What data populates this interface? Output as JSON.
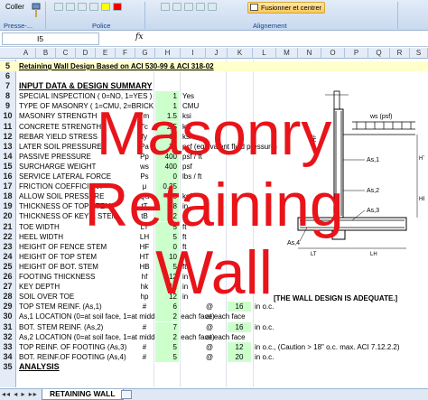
{
  "ribbon": {
    "paste_label": "Coller",
    "clipboard_group": "Presse-...",
    "font_group": "Police",
    "align_group": "Alignement",
    "merge_label": "Fusionner et centrer"
  },
  "formula_bar": {
    "name_box": "I5",
    "fx": "fx",
    "content": ""
  },
  "columns": [
    "A",
    "B",
    "C",
    "D",
    "E",
    "F",
    "G",
    "H",
    "I",
    "J",
    "K",
    "L",
    "M",
    "N",
    "O",
    "P",
    "Q",
    "R",
    "S"
  ],
  "title_row": {
    "num": "5",
    "text": "Retaining Wall Design Based on ACI 530-99 & ACI 318-02"
  },
  "rows": [
    {
      "num": "6",
      "label": "",
      "sym": "",
      "val": "",
      "unit": ""
    },
    {
      "num": "7",
      "label": "INPUT DATA & DESIGN SUMMARY",
      "sym": "",
      "val": "",
      "unit": ""
    },
    {
      "num": "8",
      "label": "SPECIAL INSPECTION ( 0=NO, 1=YES )",
      "sym": "",
      "val": "1",
      "unit": "Yes"
    },
    {
      "num": "9",
      "label": "TYPE OF MASONRY ( 1=CMU, 2=BRICK )",
      "sym": "",
      "val": "1",
      "unit": "CMU"
    },
    {
      "num": "10",
      "label": "MASONRY STRENGTH",
      "sym": "f'm",
      "val": "1.5",
      "unit": "ksi"
    },
    {
      "num": "11",
      "label": "CONCRETE STRENGTH",
      "sym": "f'c",
      "val": "2.5",
      "unit": "ksi"
    },
    {
      "num": "12",
      "label": "REBAR YIELD STRESS",
      "sym": "fy",
      "val": "60",
      "unit": "ksi"
    },
    {
      "num": "13",
      "label": "LATER SOIL PRESSURE",
      "sym": "Pa",
      "val": "30",
      "unit": "pcf (equivalent fluid pressure)"
    },
    {
      "num": "14",
      "label": "PASSIVE PRESSURE",
      "sym": "Pp",
      "val": "400",
      "unit": "psf / ft"
    },
    {
      "num": "15",
      "label": "SURCHARGE WEIGHT",
      "sym": "ws",
      "val": "400",
      "unit": "psf"
    },
    {
      "num": "16",
      "label": "SERVICE LATERAL FORCE",
      "sym": "Ps",
      "val": "0",
      "unit": "lbs / ft"
    },
    {
      "num": "17",
      "label": "FRICTION COEFFICIENT",
      "sym": "μ",
      "val": "0.35",
      "unit": ""
    },
    {
      "num": "18",
      "label": "ALLOW SOIL PRESSURE",
      "sym": "Qa",
      "val": "2.5",
      "unit": "ksf"
    },
    {
      "num": "19",
      "label": "THICKNESS OF TOP STEM",
      "sym": "tT",
      "val": "8",
      "unit": "in"
    },
    {
      "num": "20",
      "label": "THICKNESS OF KEY & STEM",
      "sym": "tB",
      "val": "12",
      "unit": "in"
    },
    {
      "num": "21",
      "label": "TOE WIDTH",
      "sym": "LT",
      "val": "5",
      "unit": "ft"
    },
    {
      "num": "22",
      "label": "HEEL WIDTH",
      "sym": "LH",
      "val": "5",
      "unit": "ft"
    },
    {
      "num": "23",
      "label": "HEIGHT OF FENCE STEM",
      "sym": "HF",
      "val": "0",
      "unit": "ft"
    },
    {
      "num": "24",
      "label": "HEIGHT OF TOP STEM",
      "sym": "HT",
      "val": "10",
      "unit": "ft"
    },
    {
      "num": "25",
      "label": "HEIGHT OF BOT. STEM",
      "sym": "HB",
      "val": "5",
      "unit": "ft"
    },
    {
      "num": "26",
      "label": "FOOTING THICKNESS",
      "sym": "hf",
      "val": "12",
      "unit": "in"
    },
    {
      "num": "27",
      "label": "KEY DEPTH",
      "sym": "hk",
      "val": "12",
      "unit": "in"
    },
    {
      "num": "28",
      "label": "SOIL OVER TOE",
      "sym": "hp",
      "val": "12",
      "unit": "in"
    }
  ],
  "reinf_rows": [
    {
      "num": "29",
      "label": "TOP STEM REINF. (As,1)",
      "sym": "#",
      "val": "6",
      "at": "@",
      "val2": "16",
      "unit2": "in o.c."
    },
    {
      "num": "30",
      "label": "As,1 LOCATION (0=at soil face, 1=at middle, 2=at each face)",
      "sym": "",
      "val": "2",
      "at": "",
      "val2": "",
      "unit2": "at each face"
    },
    {
      "num": "31",
      "label": "BOT. STEM REINF. (As,2)",
      "sym": "#",
      "val": "7",
      "at": "@",
      "val2": "16",
      "unit2": "in o.c."
    },
    {
      "num": "32",
      "label": "As,2 LOCATION (0=at soil face, 1=at middle, 2=at each face)",
      "sym": "",
      "val": "2",
      "at": "",
      "val2": "",
      "unit2": "at each face"
    },
    {
      "num": "33",
      "label": "TOP REINF. OF FOOTING (As,3)",
      "sym": "#",
      "val": "5",
      "at": "@",
      "val2": "12",
      "unit2": "in o.c., (Caution > 18\" o.c. max. ACI 7.12.2.2)"
    },
    {
      "num": "34",
      "label": "BOT. REINF.OF FOOTING (As,4)",
      "sym": "#",
      "val": "5",
      "at": "@",
      "val2": "20",
      "unit2": "in o.c."
    },
    {
      "num": "35",
      "label": "ANALYSIS",
      "sym": "",
      "val": "",
      "at": "",
      "val2": "",
      "unit2": ""
    }
  ],
  "adequate_text": "[THE WALL DESIGN IS ADEQUATE.]",
  "overlay": {
    "line1": "Masonry",
    "line2": "Retaining",
    "line3": "Wall"
  },
  "diagram_labels": {
    "ws": "ws (psf)",
    "as1": "As,1",
    "as2": "As,2",
    "as3": "As,3",
    "as4": "As,4",
    "ht": "HT",
    "hb": "HB",
    "hf": "HF",
    "lt": "LT",
    "lh": "LH",
    "tt": "tT",
    "tb": "tB"
  },
  "sheet_tab": "RETAINING WALL",
  "colors": {
    "input_fill": "#ccffcc",
    "title_fill": "#ffffcc",
    "overlay": "#e8141a"
  }
}
